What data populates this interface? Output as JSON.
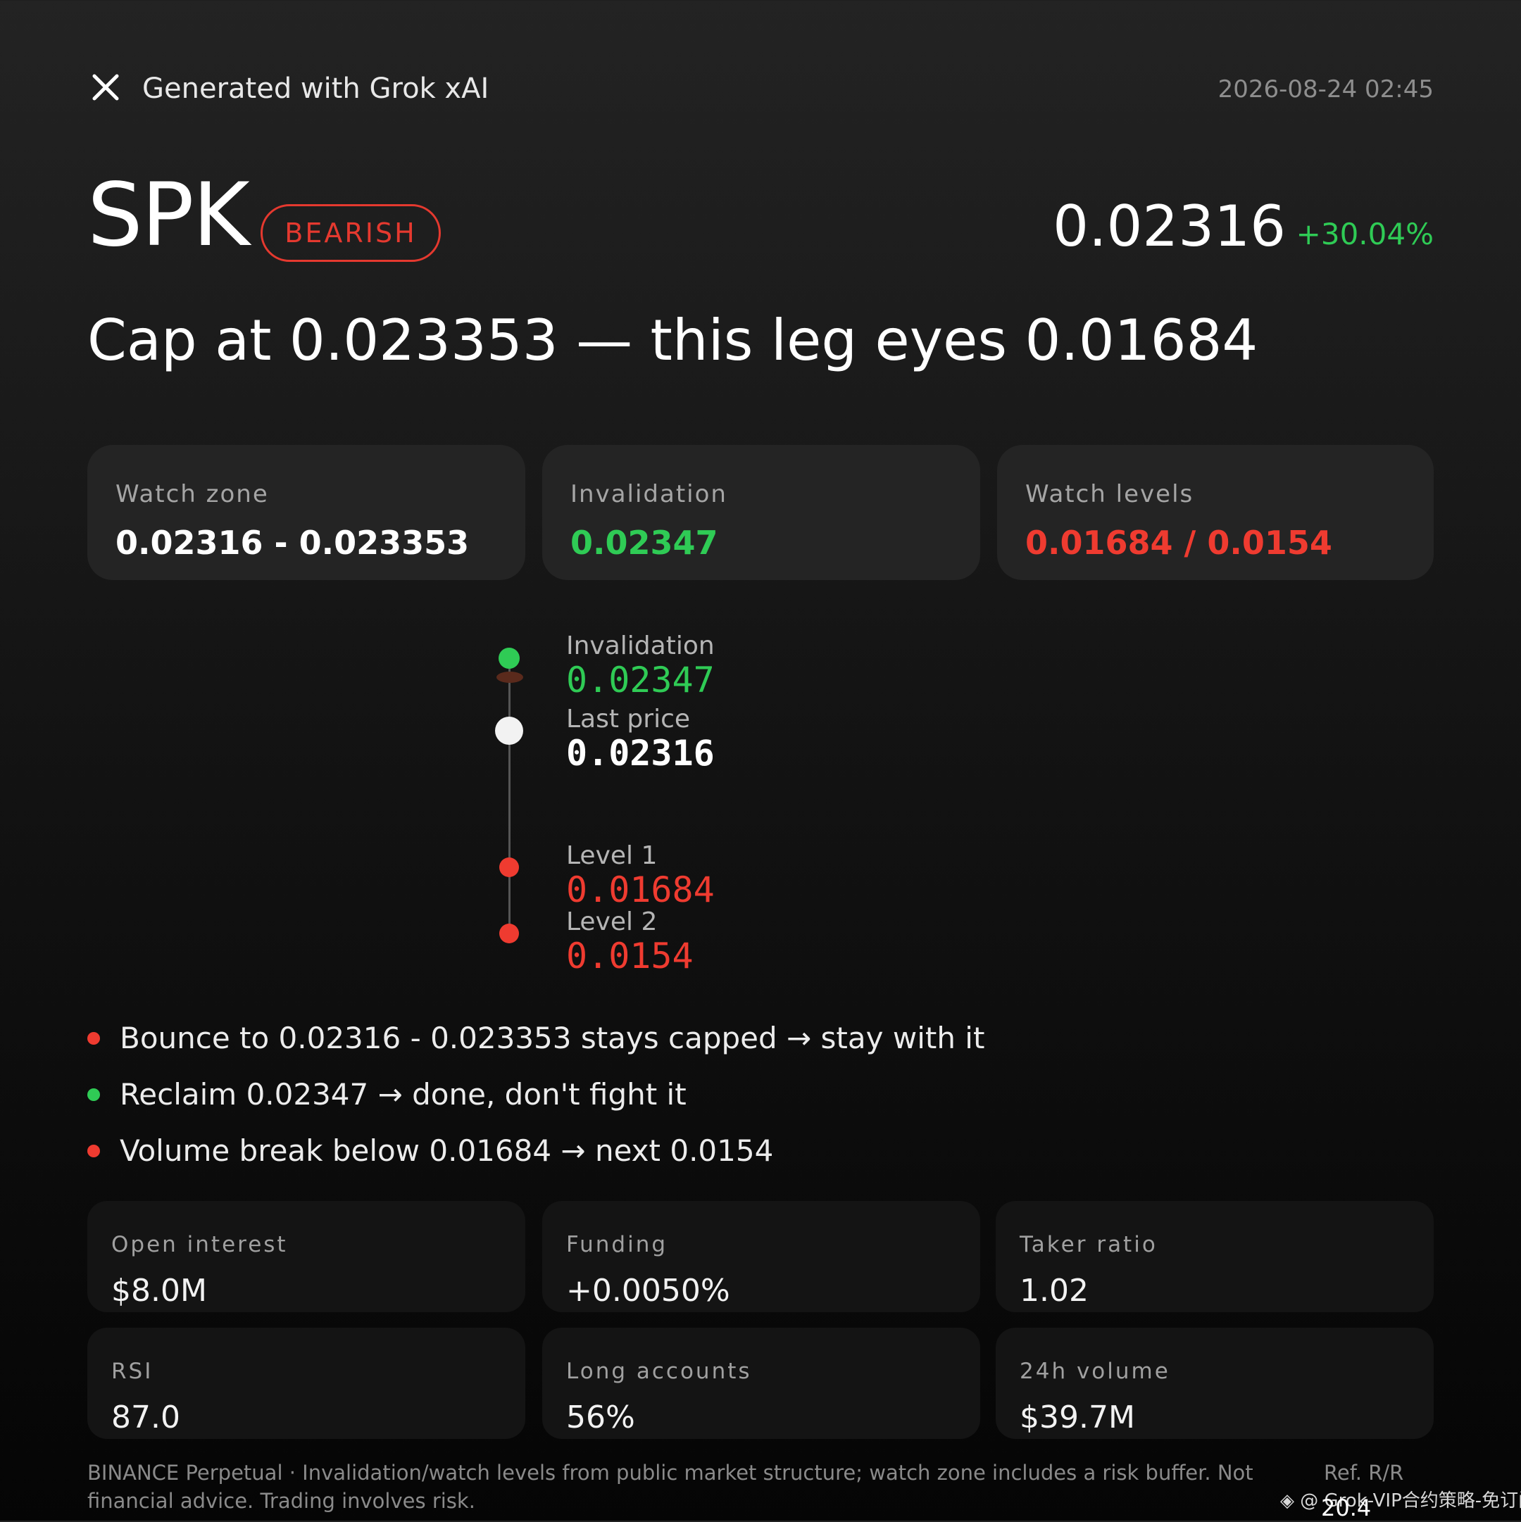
{
  "header": {
    "close_icon": "close-icon",
    "generated_label": "Generated with Grok xAI",
    "timestamp": "2026-08-24 02:45"
  },
  "ticker": {
    "symbol": "SPK",
    "bias": "BEARISH",
    "price": "0.02316",
    "change": "+30.04%"
  },
  "headline": "Cap at 0.023353 — this leg eyes 0.01684",
  "cards": [
    {
      "label": "Watch zone",
      "value": "0.02316 - 0.023353",
      "color": "#ffffff"
    },
    {
      "label": "Invalidation",
      "value": "0.02347",
      "color": "#2fcb55"
    },
    {
      "label": "Watch levels",
      "value": "0.01684 / 0.0154",
      "color": "#ef3b30"
    }
  ],
  "ladder": [
    {
      "label": "Invalidation",
      "value": "0.02347",
      "color": "#2fcb55"
    },
    {
      "label": "Last price",
      "value": "0.02316",
      "color": "#ffffff"
    },
    {
      "label": "Level 1",
      "value": "0.01684",
      "color": "#ef3b30"
    },
    {
      "label": "Level 2",
      "value": "0.0154",
      "color": "#ef3b30"
    }
  ],
  "bullets": [
    {
      "text": "Bounce to 0.02316 - 0.023353 stays capped → stay with it",
      "color": "#ef3b30"
    },
    {
      "text": "Reclaim 0.02347 → done, don't fight it",
      "color": "#2fcb55"
    },
    {
      "text": "Volume break below 0.01684 → next 0.0154",
      "color": "#ef3b30"
    }
  ],
  "stats": [
    {
      "label": "Open interest",
      "value": "$8.0M"
    },
    {
      "label": "Funding",
      "value": "+0.0050%"
    },
    {
      "label": "Taker ratio",
      "value": "1.02"
    },
    {
      "label": "RSI",
      "value": "87.0"
    },
    {
      "label": "Long accounts",
      "value": "56%"
    },
    {
      "label": "24h volume",
      "value": "$39.7M"
    }
  ],
  "footer": {
    "note": "BINANCE Perpetual · Invalidation/watch levels from public market structure; watch zone includes a risk buffer. Not financial advice. Trading involves risk.",
    "ref": "Ref. R/R",
    "ref_value": "20.4",
    "watermark": "@ Grok-VIP合约策略-免订阅"
  }
}
